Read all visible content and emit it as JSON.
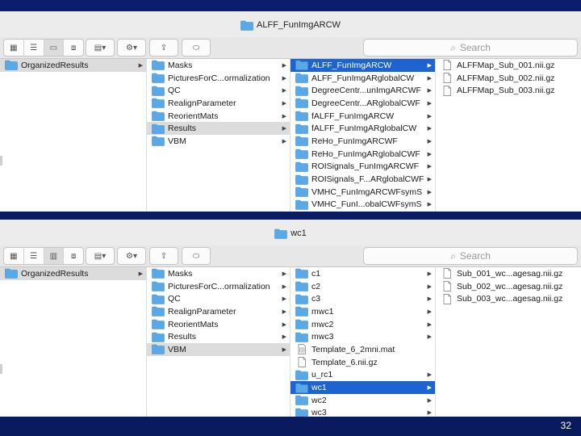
{
  "top": {
    "title": "ALFF_FunImgARCW",
    "search_placeholder": "Search",
    "col1": [
      {
        "label": "OrganizedResults",
        "selected": "grey",
        "arrow": true
      }
    ],
    "col2": [
      {
        "label": "Masks",
        "arrow": true
      },
      {
        "label": "PicturesForC...ormalization",
        "arrow": true
      },
      {
        "label": "QC",
        "arrow": true
      },
      {
        "label": "RealignParameter",
        "arrow": true
      },
      {
        "label": "ReorientMats",
        "arrow": true
      },
      {
        "label": "Results",
        "arrow": true,
        "selected": "grey"
      },
      {
        "label": "VBM",
        "arrow": true
      }
    ],
    "col3": [
      {
        "label": "ALFF_FunImgARCW",
        "arrow": true,
        "selected": "blue"
      },
      {
        "label": "ALFF_FunImgARglobalCW",
        "arrow": true
      },
      {
        "label": "DegreeCentr...unImgARCWF",
        "arrow": true
      },
      {
        "label": "DegreeCentr...ARglobalCWF",
        "arrow": true
      },
      {
        "label": "fALFF_FunImgARCW",
        "arrow": true
      },
      {
        "label": "fALFF_FunImgARglobalCW",
        "arrow": true
      },
      {
        "label": "ReHo_FunImgARCWF",
        "arrow": true
      },
      {
        "label": "ReHo_FunImgARglobalCWF",
        "arrow": true
      },
      {
        "label": "ROISignals_FunImgARCWF",
        "arrow": true
      },
      {
        "label": "ROISignals_F...ARglobalCWF",
        "arrow": true
      },
      {
        "label": "VMHC_FunImgARCWFsymS",
        "arrow": true
      },
      {
        "label": "VMHC_FunI...obalCWFsymS",
        "arrow": true
      }
    ],
    "col4": [
      {
        "label": "ALFFMap_Sub_001.nii.gz",
        "type": "file"
      },
      {
        "label": "ALFFMap_Sub_002.nii.gz",
        "type": "file"
      },
      {
        "label": "ALFFMap_Sub_003.nii.gz",
        "type": "file"
      }
    ]
  },
  "bottom": {
    "title": "wc1",
    "search_placeholder": "Search",
    "col1": [
      {
        "label": "OrganizedResults",
        "selected": "grey",
        "arrow": true
      }
    ],
    "col2": [
      {
        "label": "Masks",
        "arrow": true
      },
      {
        "label": "PicturesForC...ormalization",
        "arrow": true
      },
      {
        "label": "QC",
        "arrow": true
      },
      {
        "label": "RealignParameter",
        "arrow": true
      },
      {
        "label": "ReorientMats",
        "arrow": true
      },
      {
        "label": "Results",
        "arrow": true
      },
      {
        "label": "VBM",
        "arrow": true,
        "selected": "grey"
      }
    ],
    "col3": [
      {
        "label": "c1",
        "arrow": true
      },
      {
        "label": "c2",
        "arrow": true
      },
      {
        "label": "c3",
        "arrow": true
      },
      {
        "label": "mwc1",
        "arrow": true
      },
      {
        "label": "mwc2",
        "arrow": true
      },
      {
        "label": "mwc3",
        "arrow": true
      },
      {
        "label": "Template_6_2mni.mat",
        "type": "matfile"
      },
      {
        "label": "Template_6.nii.gz",
        "type": "file"
      },
      {
        "label": "u_rc1",
        "arrow": true
      },
      {
        "label": "wc1",
        "arrow": true,
        "selected": "blue"
      },
      {
        "label": "wc2",
        "arrow": true
      },
      {
        "label": "wc3",
        "arrow": true
      }
    ],
    "col4": [
      {
        "label": "Sub_001_wc...agesag.nii.gz",
        "type": "file"
      },
      {
        "label": "Sub_002_wc...agesag.nii.gz",
        "type": "file"
      },
      {
        "label": "Sub_003_wc...agesag.nii.gz",
        "type": "file"
      }
    ]
  },
  "slide_number": "32",
  "colors": {
    "folder": "#5aa9e6",
    "selection_blue": "#1d64d1",
    "background": "#0b1e6e"
  }
}
